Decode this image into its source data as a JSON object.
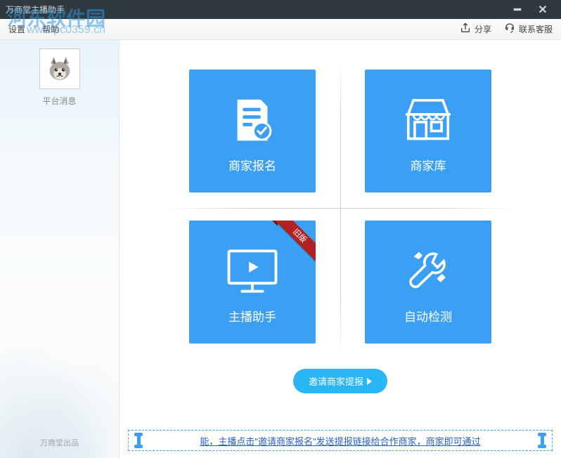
{
  "watermark": {
    "name": "河东软件园",
    "url": "www.pc0359.cn"
  },
  "window": {
    "title": "万商堂主播助手"
  },
  "menu": {
    "settings": "设置",
    "help": "帮助"
  },
  "actions": {
    "share": "分享",
    "contact": "联系客服"
  },
  "sidebar": {
    "platform_msg": "平台消息",
    "footer": "万商堂出品"
  },
  "cards": {
    "signup": {
      "label": "商家报名"
    },
    "store": {
      "label": "商家库"
    },
    "assistant": {
      "label": "主播助手",
      "ribbon": "旧版"
    },
    "autocheck": {
      "label": "自动检测"
    }
  },
  "invite": {
    "label": "邀请商家提报"
  },
  "marquee": {
    "text": "能，主播点击\"邀请商家报名\"发送提报链接给合作商家，商家即可通过"
  }
}
